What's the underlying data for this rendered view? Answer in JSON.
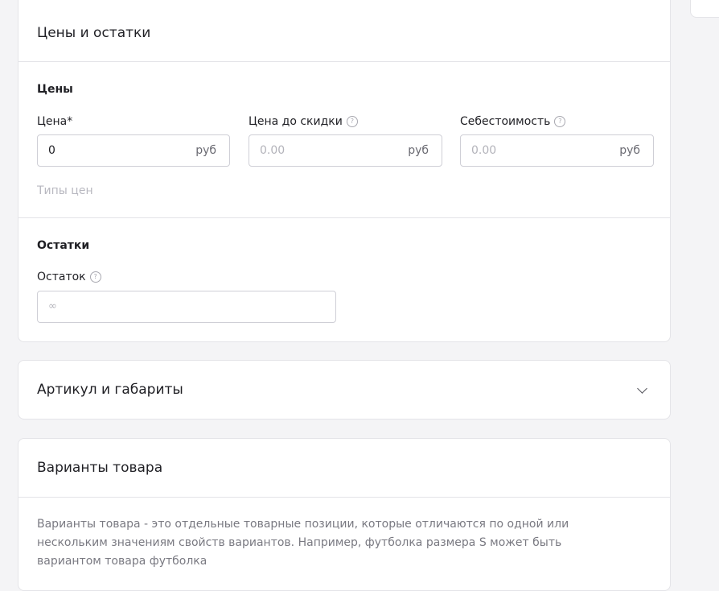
{
  "prices_card": {
    "title": "Цены и остатки",
    "prices_section": {
      "title": "Цены",
      "price": {
        "label": "Цена*",
        "value": "0",
        "suffix": "руб"
      },
      "price_before_discount": {
        "label": "Цена до скидки",
        "placeholder": "0.00",
        "suffix": "руб"
      },
      "cost": {
        "label": "Себестоимость",
        "placeholder": "0.00",
        "suffix": "руб"
      },
      "price_types_link": "Типы цен"
    },
    "stock_section": {
      "title": "Остатки",
      "stock": {
        "label": "Остаток",
        "placeholder": "∞"
      }
    }
  },
  "article_card": {
    "title": "Артикул и габариты"
  },
  "variants_card": {
    "title": "Варианты товара",
    "description": "Варианты товара - это отдельные товарные позиции, которые отличаются по одной или нескольким значениям свойств вариантов. Например, футболка размера S может быть вариантом товара футболка"
  },
  "icons": {
    "help": "question-circle-icon",
    "collapse": "chevron-down-icon"
  },
  "colors": {
    "background": "#f4f4f6",
    "card": "#ffffff",
    "border": "#e4e4e8",
    "muted_text": "#b8b8c0"
  }
}
